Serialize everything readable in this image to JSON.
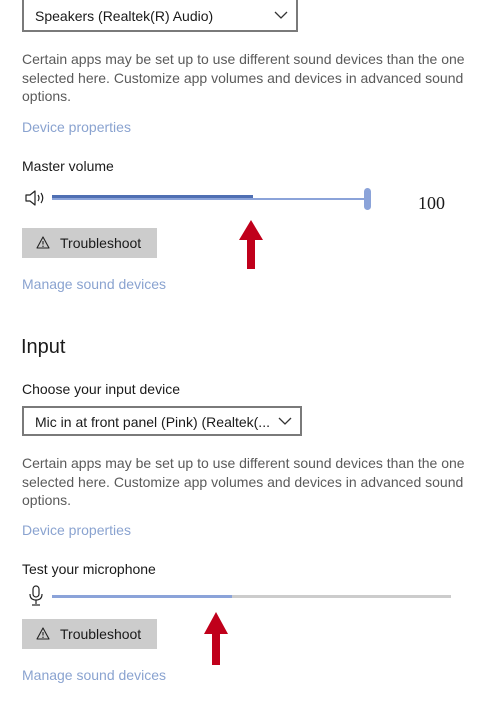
{
  "output": {
    "device_selected": "Speakers (Realtek(R) Audio)",
    "description": "Certain apps may be set up to use different sound devices than the one selected here. Customize app volumes and devices in advanced sound options.",
    "device_properties_link": "Device properties",
    "master_volume_label": "Master volume",
    "master_volume_value": "100",
    "master_volume_fraction": 1.0,
    "volume_icon": "speaker-icon",
    "troubleshoot_label": "Troubleshoot",
    "manage_link": "Manage sound devices"
  },
  "input": {
    "heading": "Input",
    "choose_label": "Choose your input device",
    "device_selected": "Mic in at front panel (Pink) (Realtek(...",
    "description": "Certain apps may be set up to use different sound devices than the one selected here. Customize app volumes and devices in advanced sound options.",
    "device_properties_link": "Device properties",
    "test_label": "Test your microphone",
    "mic_icon": "microphone-icon",
    "mic_level_fraction": 0.45,
    "troubleshoot_label": "Troubleshoot",
    "manage_link": "Manage sound devices"
  },
  "colors": {
    "link": "#8aa3d0",
    "slider_accent": "#8ba3d9",
    "slider_dark": "#4f6fb3",
    "button_bg": "#cccccc",
    "annotation_arrow": "#c0001b"
  }
}
